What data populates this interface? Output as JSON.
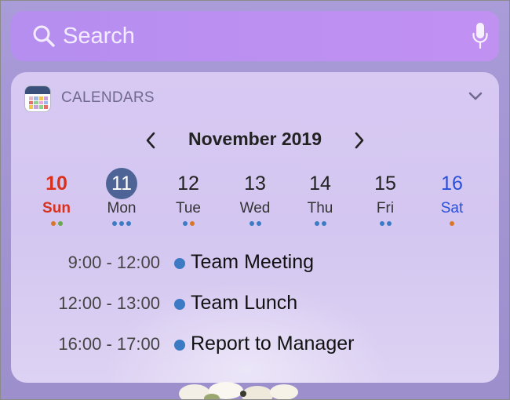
{
  "search": {
    "placeholder": "Search"
  },
  "widget": {
    "title": "CALENDARS",
    "month_title": "November 2019"
  },
  "days": [
    {
      "number": "10",
      "weekday": "Sun",
      "dots": [
        "#d9762a",
        "#6aa84f"
      ]
    },
    {
      "number": "11",
      "weekday": "Mon",
      "dots": [
        "#3c7ac4",
        "#3c7ac4",
        "#3c7ac4"
      ]
    },
    {
      "number": "12",
      "weekday": "Tue",
      "dots": [
        "#3c7ac4",
        "#d9762a"
      ]
    },
    {
      "number": "13",
      "weekday": "Wed",
      "dots": [
        "#3c7ac4",
        "#3c7ac4"
      ]
    },
    {
      "number": "14",
      "weekday": "Thu",
      "dots": [
        "#3c7ac4",
        "#3c7ac4"
      ]
    },
    {
      "number": "15",
      "weekday": "Fri",
      "dots": [
        "#3c7ac4",
        "#3c7ac4"
      ]
    },
    {
      "number": "16",
      "weekday": "Sat",
      "dots": [
        "#d9762a"
      ]
    }
  ],
  "events": [
    {
      "time": "9:00 - 12:00",
      "title": "Team Meeting"
    },
    {
      "time": "12:00 - 13:00",
      "title": "Team Lunch"
    },
    {
      "time": "16:00 - 17:00",
      "title": "Report to Manager"
    }
  ],
  "colors": {
    "today_circle": "#4f6496",
    "sunday": "#d8321f",
    "saturday": "#2a4fd8",
    "event_dot": "#3c7ac4"
  }
}
